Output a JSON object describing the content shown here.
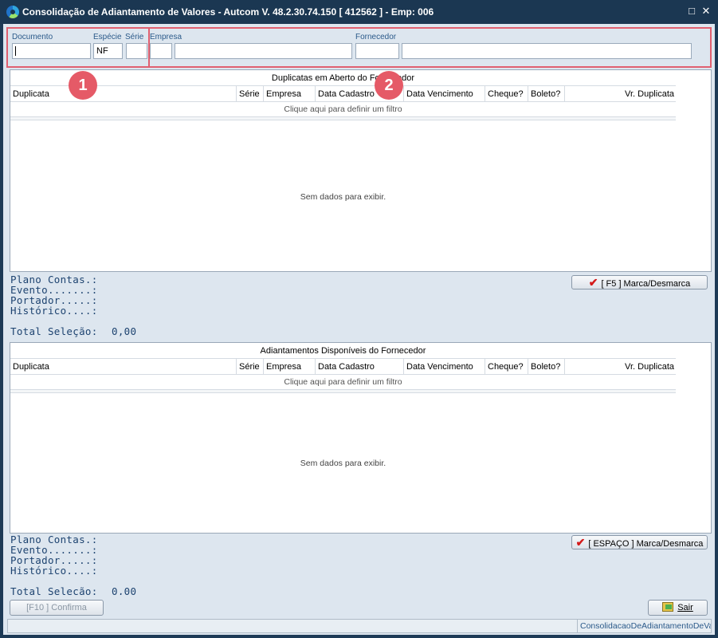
{
  "window": {
    "title": "Consolidação de Adiantamento de Valores   -   Autcom V. 48.2.30.74.150 [ 412562 ] - Emp: 006",
    "minimize_glyph": "□",
    "close_glyph": "✕"
  },
  "filters": {
    "documento_label": "Documento",
    "documento_value": "",
    "especie_label": "Espécie",
    "especie_value": "NF",
    "serie_label": "Série",
    "serie_value": "",
    "empresa_label": "Empresa",
    "empresa_code": "",
    "empresa_name": "",
    "fornecedor_label": "Fornecedor",
    "fornecedor_code": "",
    "fornecedor_name": ""
  },
  "badges": {
    "one": "1",
    "two": "2"
  },
  "grid1": {
    "title": "Duplicatas em Aberto do Fornecedor",
    "columns": [
      "Duplicata",
      "Série",
      "Empresa",
      "Data Cadastro",
      "Data Vencimento",
      "Cheque?",
      "Boleto?",
      "Vr. Duplicata"
    ],
    "filter_hint": "Clique aqui para definir um filtro",
    "empty_text": "Sem dados para exibir."
  },
  "info1": {
    "plano_contas": "Plano Contas.:",
    "evento": "Evento.......:",
    "portador": "Portador.....:",
    "historico": "Histórico....:",
    "total_label": "Total Seleção:",
    "total_value": "0,00",
    "button": "[ F5 ] Marca/Desmarca"
  },
  "grid2": {
    "title": "Adiantamentos Disponíveis do Fornecedor",
    "columns": [
      "Duplicata",
      "Série",
      "Empresa",
      "Data Cadastro",
      "Data Vencimento",
      "Cheque?",
      "Boleto?",
      "Vr. Duplicata"
    ],
    "filter_hint": "Clique aqui para definir um filtro",
    "empty_text": "Sem dados para exibir."
  },
  "info2": {
    "plano_contas": "Plano Contas.:",
    "evento": "Evento.......:",
    "portador": "Portador.....:",
    "historico": "Histórico....:",
    "total_label": "Total Seleção:",
    "total_value": "0,00",
    "button": "[ ESPAÇO ] Marca/Desmarca"
  },
  "footer": {
    "confirm_button": "[F10 ] Confirma",
    "exit_button": "Sair",
    "status_text": "ConsolidacaoDeAdiantamentoDeVal"
  },
  "colors": {
    "title_bar": "#1b3752",
    "panel_bg": "#dde6ef",
    "label_blue": "#2b5a8a",
    "highlight": "#e06070",
    "check_red": "#d41a1a"
  }
}
